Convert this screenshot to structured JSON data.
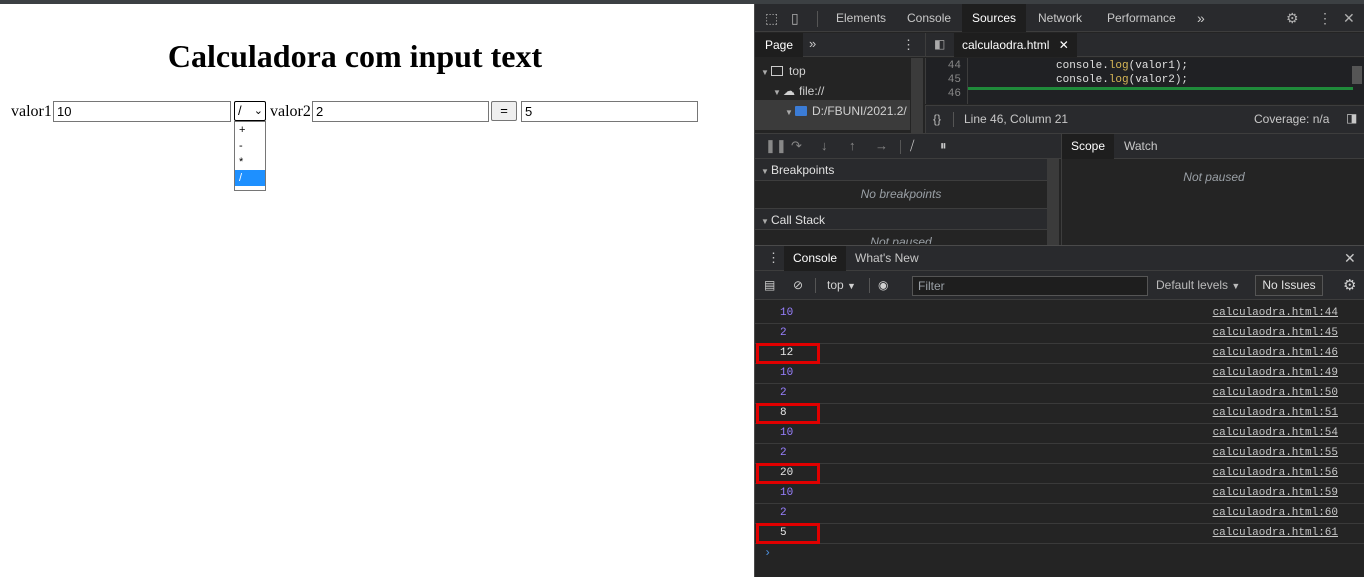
{
  "page": {
    "title": "Calculadora com input text",
    "valor1_label": "valor1",
    "valor1_value": "10",
    "operator_selected": "/",
    "valor2_label": "valor2",
    "valor2_value": "2",
    "equals_label": "=",
    "result_value": "5",
    "operator_options": [
      "+",
      "-",
      "*",
      "/"
    ]
  },
  "devtools": {
    "tabs": [
      "Elements",
      "Console",
      "Sources",
      "Network",
      "Performance"
    ],
    "active_tab": "Sources",
    "more_tabs": "»",
    "navigator": {
      "tab": "Page",
      "more": "»",
      "tree": [
        "top",
        "file://",
        "D:/FBUNI/2021.2/"
      ]
    },
    "editor": {
      "file_tab": "calculaodra.html",
      "lines": [
        {
          "num": "44",
          "pre": "console.",
          "fn": "log",
          "post": "(valor1);"
        },
        {
          "num": "45",
          "pre": "console.",
          "fn": "log",
          "post": "(valor2);"
        },
        {
          "num": "46",
          "pre": "",
          "fn": "",
          "post": ""
        }
      ],
      "status_position": "Line 46, Column 21",
      "coverage": "Coverage: n/a",
      "format_icon": "{}"
    },
    "debugger": {
      "breakpoints_title": "Breakpoints",
      "no_breakpoints": "No breakpoints",
      "call_stack_title": "Call Stack",
      "not_paused": "Not paused",
      "scope_tab": "Scope",
      "watch_tab": "Watch",
      "scope_not_paused": "Not paused"
    },
    "drawer": {
      "console_tab": "Console",
      "whats_new_tab": "What's New",
      "context": "top",
      "filter_placeholder": "Filter",
      "default_levels": "Default levels",
      "no_issues": "No Issues",
      "prompt": "›",
      "logs": [
        {
          "value": "10",
          "type": "num",
          "source": "calculaodra.html:44",
          "highlight": false
        },
        {
          "value": "2",
          "type": "num",
          "source": "calculaodra.html:45",
          "highlight": false
        },
        {
          "value": "12",
          "type": "res",
          "source": "calculaodra.html:46",
          "highlight": true
        },
        {
          "value": "10",
          "type": "num",
          "source": "calculaodra.html:49",
          "highlight": false
        },
        {
          "value": "2",
          "type": "num",
          "source": "calculaodra.html:50",
          "highlight": false
        },
        {
          "value": "8",
          "type": "res",
          "source": "calculaodra.html:51",
          "highlight": true
        },
        {
          "value": "10",
          "type": "num",
          "source": "calculaodra.html:54",
          "highlight": false
        },
        {
          "value": "2",
          "type": "num",
          "source": "calculaodra.html:55",
          "highlight": false
        },
        {
          "value": "20",
          "type": "res",
          "source": "calculaodra.html:56",
          "highlight": true
        },
        {
          "value": "10",
          "type": "num",
          "source": "calculaodra.html:59",
          "highlight": false
        },
        {
          "value": "2",
          "type": "num",
          "source": "calculaodra.html:60",
          "highlight": false
        },
        {
          "value": "5",
          "type": "res",
          "source": "calculaodra.html:61",
          "highlight": true
        }
      ]
    }
  }
}
